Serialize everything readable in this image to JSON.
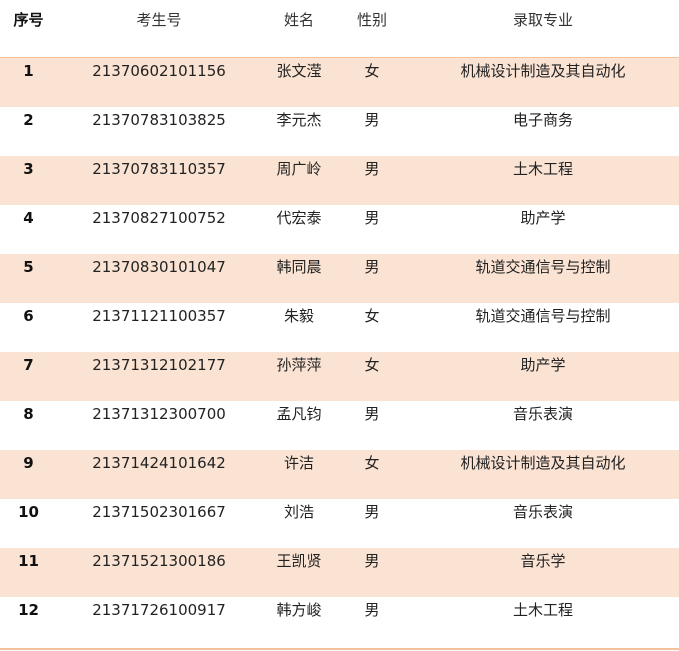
{
  "headers": {
    "seq": "序号",
    "exam_no": "考生号",
    "name": "姓名",
    "sex": "性别",
    "major": "录取专业"
  },
  "rows": [
    {
      "seq": "1",
      "exam_no": "21370602101156",
      "name": "张文滢",
      "sex": "女",
      "major": "机械设计制造及其自动化"
    },
    {
      "seq": "2",
      "exam_no": "21370783103825",
      "name": "李元杰",
      "sex": "男",
      "major": "电子商务"
    },
    {
      "seq": "3",
      "exam_no": "21370783110357",
      "name": "周广岭",
      "sex": "男",
      "major": "土木工程"
    },
    {
      "seq": "4",
      "exam_no": "21370827100752",
      "name": "代宏泰",
      "sex": "男",
      "major": "助产学"
    },
    {
      "seq": "5",
      "exam_no": "21370830101047",
      "name": "韩同晨",
      "sex": "男",
      "major": "轨道交通信号与控制"
    },
    {
      "seq": "6",
      "exam_no": "21371121100357",
      "name": "朱毅",
      "sex": "女",
      "major": "轨道交通信号与控制"
    },
    {
      "seq": "7",
      "exam_no": "21371312102177",
      "name": "孙萍萍",
      "sex": "女",
      "major": "助产学"
    },
    {
      "seq": "8",
      "exam_no": "21371312300700",
      "name": "孟凡钧",
      "sex": "男",
      "major": "音乐表演"
    },
    {
      "seq": "9",
      "exam_no": "21371424101642",
      "name": "许洁",
      "sex": "女",
      "major": "机械设计制造及其自动化"
    },
    {
      "seq": "10",
      "exam_no": "21371502301667",
      "name": "刘浩",
      "sex": "男",
      "major": "音乐表演"
    },
    {
      "seq": "11",
      "exam_no": "21371521300186",
      "name": "王凯贤",
      "sex": "男",
      "major": "音乐学"
    },
    {
      "seq": "12",
      "exam_no": "21371726100917",
      "name": "韩方峻",
      "sex": "男",
      "major": "土木工程"
    }
  ],
  "colors": {
    "shaded_row": "#fbe3d3",
    "rule": "#f3c29d"
  }
}
